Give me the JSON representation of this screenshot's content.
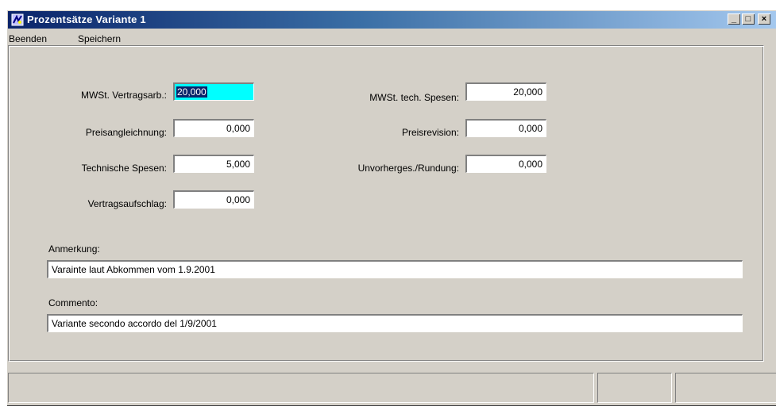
{
  "window": {
    "title": "Prozentsätze Variante 1",
    "controls": {
      "minimize": "_",
      "maximize": "□",
      "close": "×"
    }
  },
  "menu": {
    "items": [
      "Beenden",
      "Speichern"
    ]
  },
  "form": {
    "mwst_vertragsarb": {
      "label": "MWSt. Vertragsarb.:",
      "value": "20,000"
    },
    "preisangleichnung": {
      "label": "Preisangleichnung:",
      "value": "0,000"
    },
    "technische_spesen": {
      "label": "Technische Spesen:",
      "value": "5,000"
    },
    "vertragsaufschlag": {
      "label": "Vertragsaufschlag:",
      "value": "0,000"
    },
    "mwst_tech_spesen": {
      "label": "MWSt. tech. Spesen:",
      "value": "20,000"
    },
    "preisrevision": {
      "label": "Preisrevision:",
      "value": "0,000"
    },
    "unvorherges_rundung": {
      "label": "Unvorherges./Rundung:",
      "value": "0,000"
    },
    "anmerkung": {
      "label": "Anmerkung:",
      "value": "Varainte laut Abkommen vom 1.9.2001"
    },
    "commento": {
      "label": "Commento:",
      "value": "Variante secondo accordo del 1/9/2001"
    }
  },
  "colors": {
    "active_field": "#00ffff",
    "selection": "#0a246a",
    "titlebar_start": "#0a246a",
    "titlebar_end": "#a6caf0",
    "face": "#d4d0c8"
  }
}
